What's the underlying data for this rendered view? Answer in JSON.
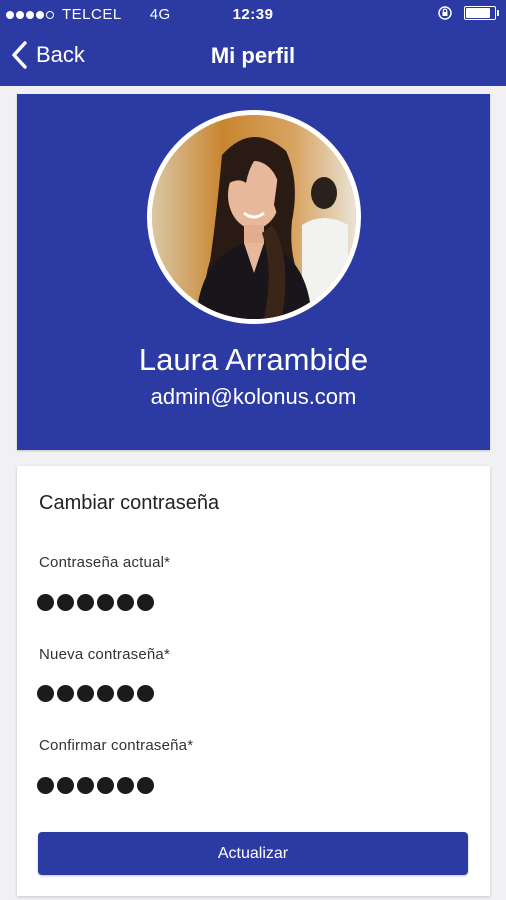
{
  "status_bar": {
    "carrier": "TELCEL",
    "network": "4G",
    "time": "12:39",
    "signal_bars": 4,
    "signal_total": 5,
    "battery_level": 0.85
  },
  "nav": {
    "back_label": "Back",
    "title": "Mi perfil"
  },
  "profile": {
    "name": "Laura Arrambide",
    "email": "admin@kolonus.com"
  },
  "password_form": {
    "title": "Cambiar contraseña",
    "fields": [
      {
        "label": "Contraseña actual*",
        "masked_length": 6
      },
      {
        "label": "Nueva contraseña*",
        "masked_length": 6
      },
      {
        "label": "Confirmar contraseña*",
        "masked_length": 6
      }
    ],
    "submit_label": "Actualizar"
  },
  "colors": {
    "primary": "#2c3aa3",
    "background": "#f1f1f3"
  },
  "icons": {
    "back": "chevron-left-icon",
    "lock": "orientation-lock-icon",
    "battery": "battery-icon"
  }
}
